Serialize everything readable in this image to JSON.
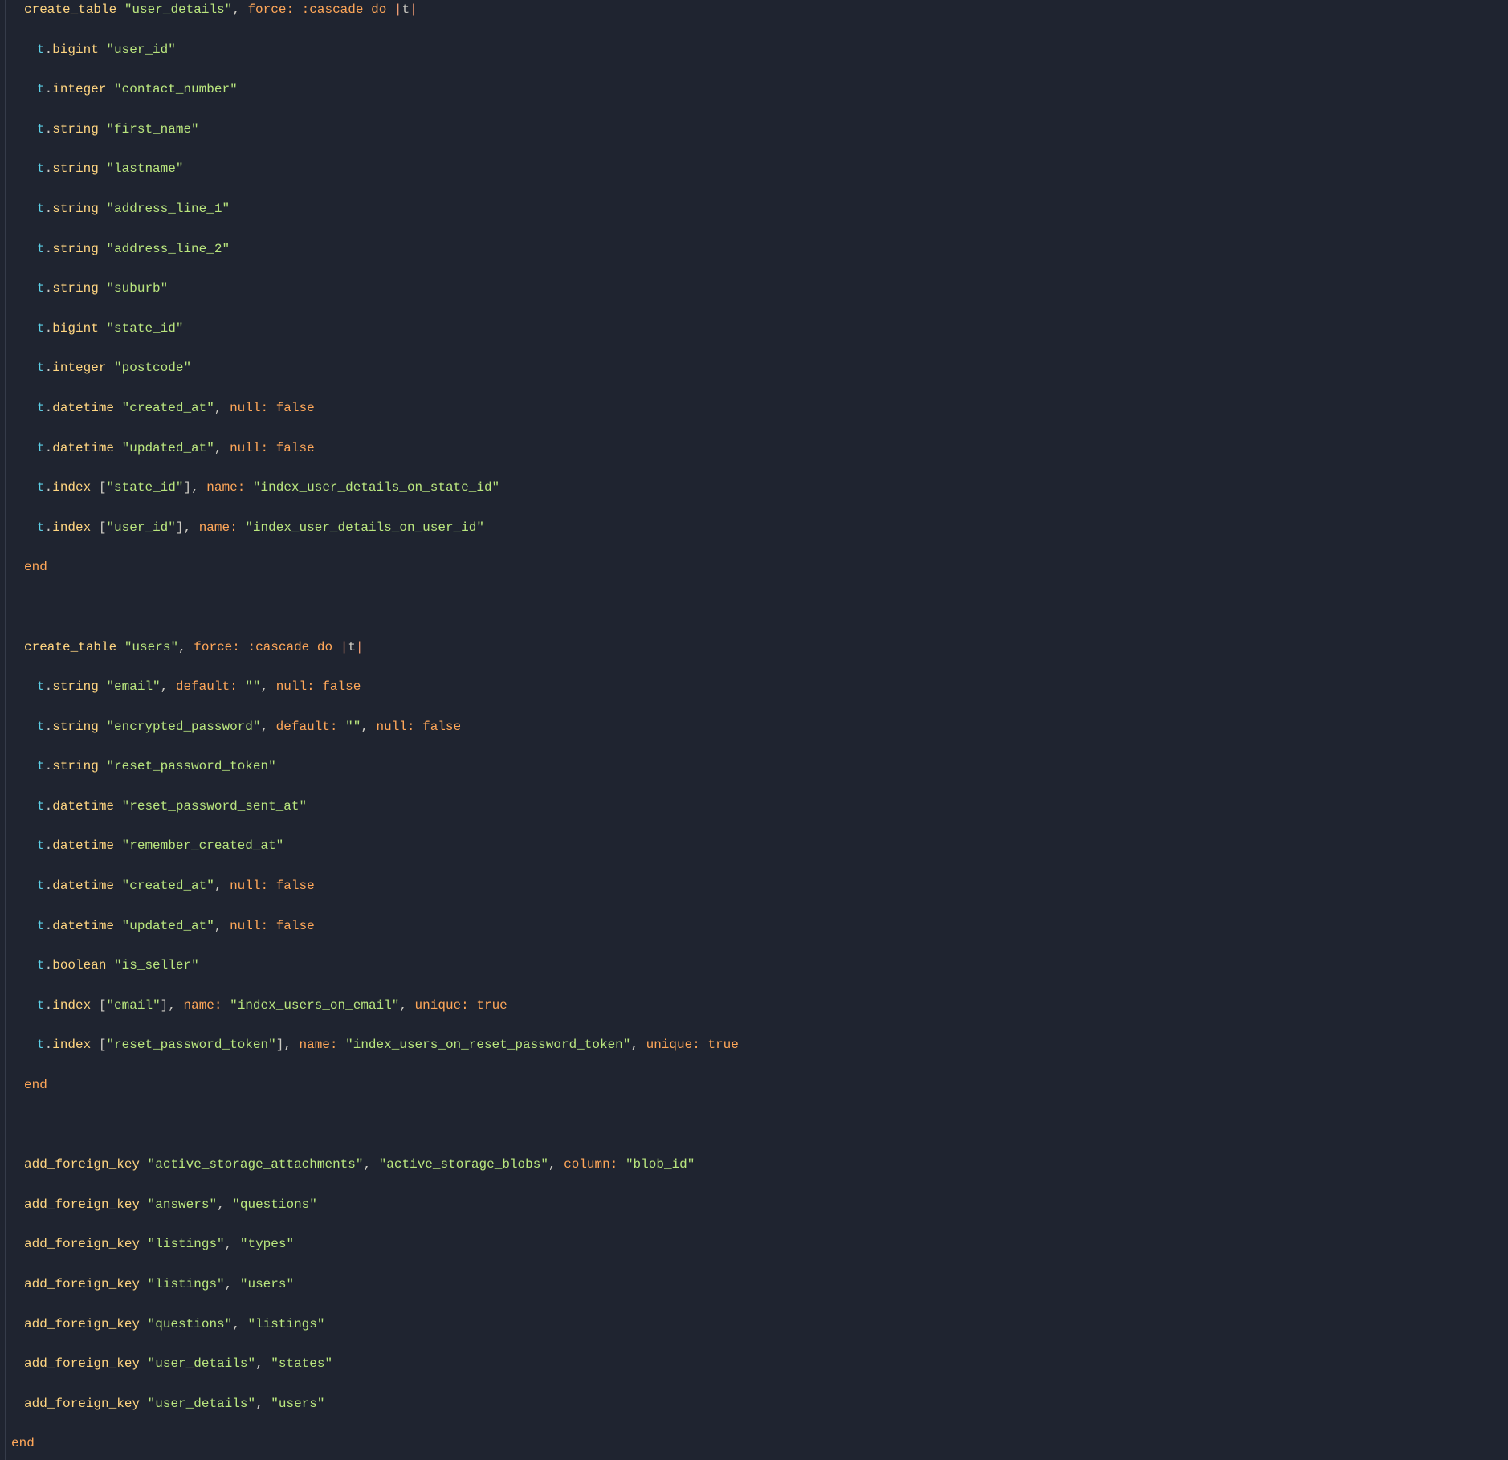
{
  "tables": {
    "user_details": {
      "create_fn": "create_table",
      "name": "\"user_details\"",
      "force_label": "force:",
      "cascade": ":cascade",
      "do": "do",
      "pipe_t": "|t|",
      "end": "end",
      "columns": [
        {
          "var": "t",
          "dot": ".",
          "method": "bigint",
          "arg": "\"user_id\""
        },
        {
          "var": "t",
          "dot": ".",
          "method": "integer",
          "arg": "\"contact_number\""
        },
        {
          "var": "t",
          "dot": ".",
          "method": "string",
          "arg": "\"first_name\""
        },
        {
          "var": "t",
          "dot": ".",
          "method": "string",
          "arg": "\"lastname\""
        },
        {
          "var": "t",
          "dot": ".",
          "method": "string",
          "arg": "\"address_line_1\""
        },
        {
          "var": "t",
          "dot": ".",
          "method": "string",
          "arg": "\"address_line_2\""
        },
        {
          "var": "t",
          "dot": ".",
          "method": "string",
          "arg": "\"suburb\""
        },
        {
          "var": "t",
          "dot": ".",
          "method": "bigint",
          "arg": "\"state_id\""
        },
        {
          "var": "t",
          "dot": ".",
          "method": "integer",
          "arg": "\"postcode\""
        },
        {
          "var": "t",
          "dot": ".",
          "method": "datetime",
          "arg": "\"created_at\"",
          "extra_label": "null:",
          "extra_val": "false"
        },
        {
          "var": "t",
          "dot": ".",
          "method": "datetime",
          "arg": "\"updated_at\"",
          "extra_label": "null:",
          "extra_val": "false"
        },
        {
          "var": "t",
          "dot": ".",
          "method": "index",
          "bracket_open": "[",
          "index_col": "\"state_id\"",
          "bracket_close": "]",
          "name_label": "name:",
          "name_val": "\"index_user_details_on_state_id\""
        },
        {
          "var": "t",
          "dot": ".",
          "method": "index",
          "bracket_open": "[",
          "index_col": "\"user_id\"",
          "bracket_close": "]",
          "name_label": "name:",
          "name_val": "\"index_user_details_on_user_id\""
        }
      ]
    },
    "users": {
      "create_fn": "create_table",
      "name": "\"users\"",
      "force_label": "force:",
      "cascade": ":cascade",
      "do": "do",
      "pipe_t": "|t|",
      "end": "end",
      "columns": [
        {
          "var": "t",
          "dot": ".",
          "method": "string",
          "arg": "\"email\"",
          "default_label": "default:",
          "default_val": "\"\"",
          "null_label": "null:",
          "null_val": "false"
        },
        {
          "var": "t",
          "dot": ".",
          "method": "string",
          "arg": "\"encrypted_password\"",
          "default_label": "default:",
          "default_val": "\"\"",
          "null_label": "null:",
          "null_val": "false"
        },
        {
          "var": "t",
          "dot": ".",
          "method": "string",
          "arg": "\"reset_password_token\""
        },
        {
          "var": "t",
          "dot": ".",
          "method": "datetime",
          "arg": "\"reset_password_sent_at\""
        },
        {
          "var": "t",
          "dot": ".",
          "method": "datetime",
          "arg": "\"remember_created_at\""
        },
        {
          "var": "t",
          "dot": ".",
          "method": "datetime",
          "arg": "\"created_at\"",
          "null_label": "null:",
          "null_val": "false"
        },
        {
          "var": "t",
          "dot": ".",
          "method": "datetime",
          "arg": "\"updated_at\"",
          "null_label": "null:",
          "null_val": "false"
        },
        {
          "var": "t",
          "dot": ".",
          "method": "boolean",
          "arg": "\"is_seller\""
        },
        {
          "var": "t",
          "dot": ".",
          "method": "index",
          "bracket_open": "[",
          "index_col": "\"email\"",
          "bracket_close": "]",
          "name_label": "name:",
          "name_val": "\"index_users_on_email\"",
          "unique_label": "unique:",
          "unique_val": "true"
        },
        {
          "var": "t",
          "dot": ".",
          "method": "index",
          "bracket_open": "[",
          "index_col": "\"reset_password_token\"",
          "bracket_close": "]",
          "name_label": "name:",
          "name_val": "\"index_users_on_reset_password_token\"",
          "unique_label": "unique:",
          "unique_val": "true"
        }
      ]
    }
  },
  "fks": [
    {
      "fn": "add_foreign_key",
      "a": "\"active_storage_attachments\"",
      "b": "\"active_storage_blobs\"",
      "col_label": "column:",
      "col_val": "\"blob_id\""
    },
    {
      "fn": "add_foreign_key",
      "a": "\"answers\"",
      "b": "\"questions\""
    },
    {
      "fn": "add_foreign_key",
      "a": "\"listings\"",
      "b": "\"types\""
    },
    {
      "fn": "add_foreign_key",
      "a": "\"listings\"",
      "b": "\"users\""
    },
    {
      "fn": "add_foreign_key",
      "a": "\"questions\"",
      "b": "\"listings\""
    },
    {
      "fn": "add_foreign_key",
      "a": "\"user_details\"",
      "b": "\"states\""
    },
    {
      "fn": "add_foreign_key",
      "a": "\"user_details\"",
      "b": "\"users\""
    }
  ],
  "final_end": "end",
  "blank": " "
}
